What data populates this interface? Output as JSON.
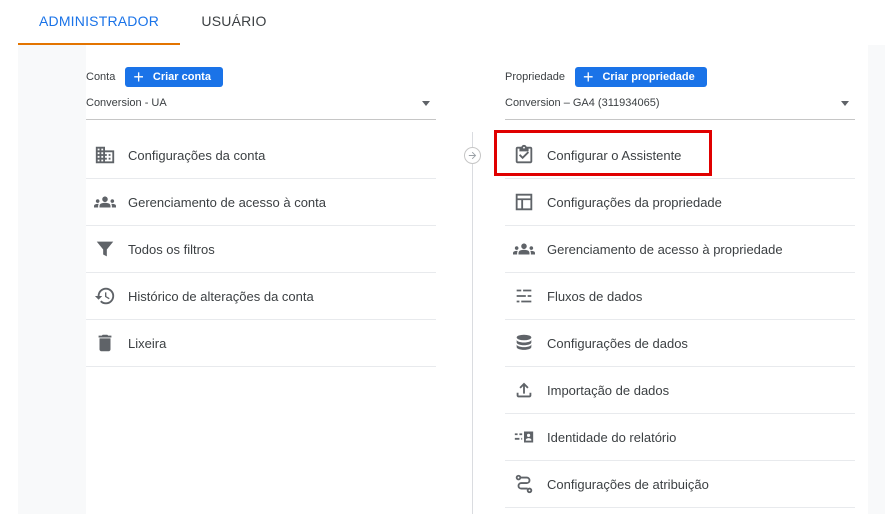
{
  "tabs": [
    {
      "label": "ADMINISTRADOR"
    },
    {
      "label": "USUÁRIO"
    }
  ],
  "account": {
    "label": "Conta",
    "create_button": "Criar conta",
    "selected": "Conversion - UA",
    "items": [
      {
        "label": "Configurações da conta",
        "icon": "building-icon"
      },
      {
        "label": "Gerenciamento de acesso à conta",
        "icon": "people-icon"
      },
      {
        "label": "Todos os filtros",
        "icon": "filter-icon"
      },
      {
        "label": "Histórico de alterações da conta",
        "icon": "history-icon"
      },
      {
        "label": "Lixeira",
        "icon": "trash-icon"
      }
    ]
  },
  "property": {
    "label": "Propriedade",
    "create_button": "Criar propriedade",
    "selected": "Conversion – GA4 (311934065)",
    "items": [
      {
        "label": "Configurar o Assistente",
        "icon": "clipboard-check-icon"
      },
      {
        "label": "Configurações da propriedade",
        "icon": "layout-icon"
      },
      {
        "label": "Gerenciamento de acesso à propriedade",
        "icon": "people-icon"
      },
      {
        "label": "Fluxos de dados",
        "icon": "streams-icon"
      },
      {
        "label": "Configurações de dados",
        "icon": "database-icon"
      },
      {
        "label": "Importação de dados",
        "icon": "upload-icon"
      },
      {
        "label": "Identidade do relatório",
        "icon": "id-card-icon"
      },
      {
        "label": "Configurações de atribuição",
        "icon": "route-icon"
      }
    ]
  },
  "colors": {
    "accent": "#1a73e8",
    "tab_indicator": "#e37400",
    "highlight": "#e00000"
  }
}
